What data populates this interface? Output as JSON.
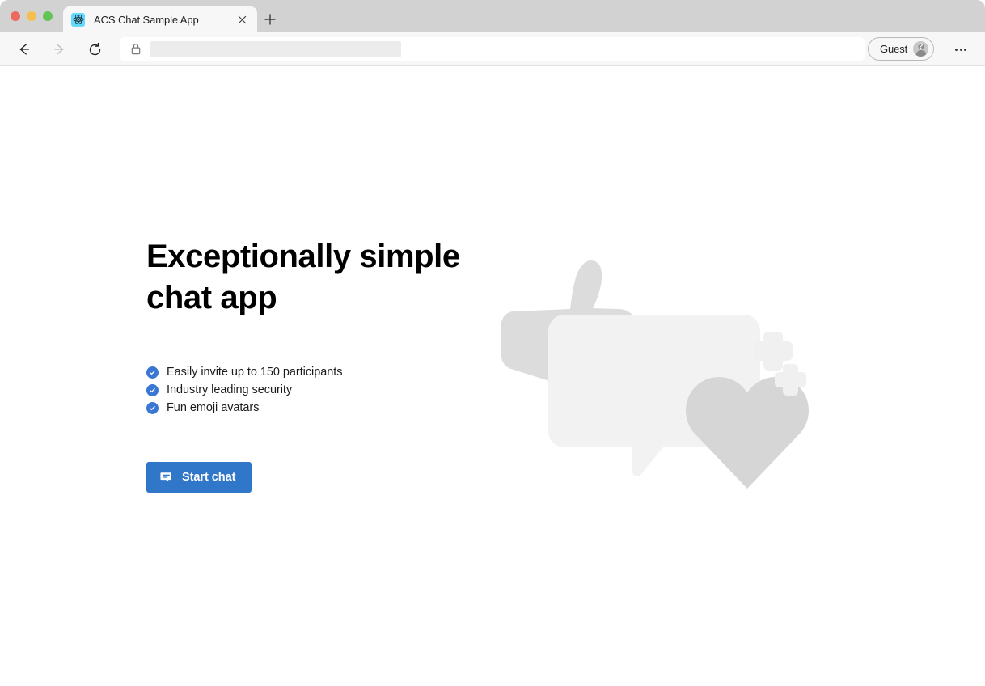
{
  "browser": {
    "window_controls": [
      {
        "name": "close",
        "color": "#ed6a5f"
      },
      {
        "name": "minimize",
        "color": "#f4bf50"
      },
      {
        "name": "maximize",
        "color": "#61c454"
      }
    ],
    "tab": {
      "title": "ACS Chat Sample App",
      "favicon_icon": "react-logo-icon",
      "close_icon": "close-icon",
      "close_glyph": "✕"
    },
    "new_tab_glyph": "+",
    "toolbar": {
      "back_icon": "back-arrow-icon",
      "forward_icon": "forward-arrow-icon",
      "reload_icon": "reload-icon",
      "lock_icon": "lock-icon",
      "address_value": "",
      "address_placeholder": ""
    },
    "profile": {
      "label": "Guest",
      "avatar_icon": "guest-avatar-icon",
      "badge_glyph": "?"
    },
    "more_icon": "more-options-icon"
  },
  "page": {
    "hero": {
      "title": "Exceptionally simple\nchat app",
      "features": [
        {
          "check_icon": "check-circle-icon",
          "label": "Easily invite up to 150 participants"
        },
        {
          "check_icon": "check-circle-icon",
          "label": "Industry leading security"
        },
        {
          "check_icon": "check-circle-icon",
          "label": "Fun emoji avatars"
        }
      ],
      "cta": {
        "label": "Start chat",
        "icon": "chat-bubble-icon"
      }
    },
    "illustration": {
      "shapes": [
        "thumbs-up",
        "speech-bubble",
        "heart",
        "plus-sparkle"
      ],
      "colors": {
        "thumb": "#dcdcdc",
        "bubble": "#f2f2f2",
        "heart": "#d6d6d6",
        "sparkle": "#f0f0f0"
      }
    }
  },
  "theme": {
    "accent_blue": "#3076c9",
    "check_blue": "#3a76d4",
    "tabstrip_gray": "#d2d2d2",
    "toolbar_gray": "#f7f7f7"
  }
}
